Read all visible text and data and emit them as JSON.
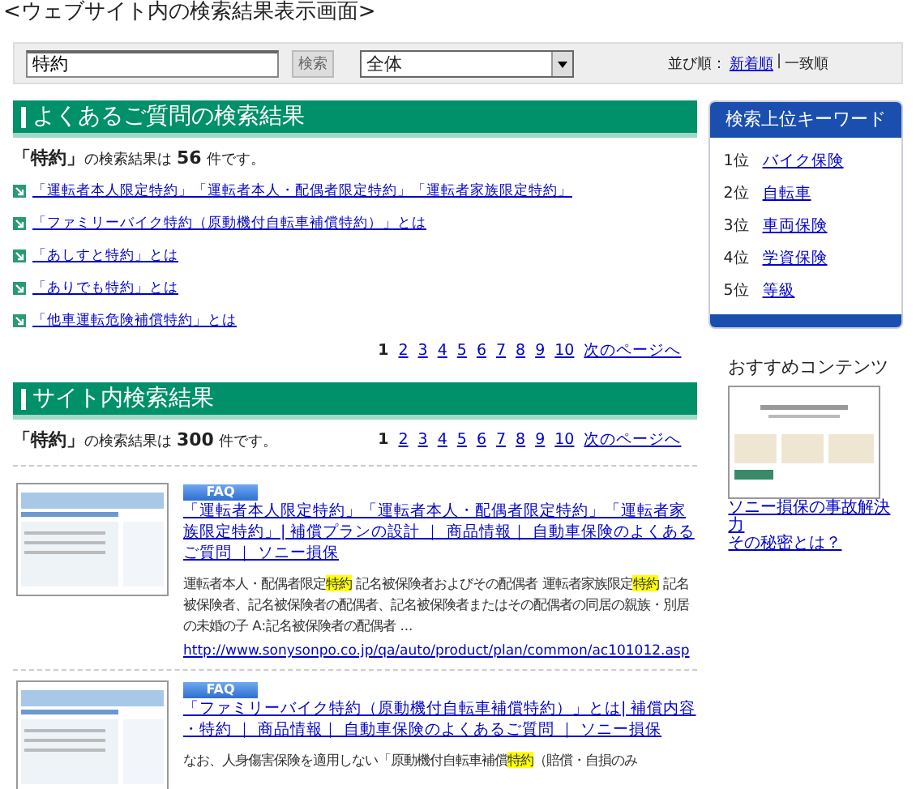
{
  "page_title": "<ウェブサイト内の検索結果表示画面>",
  "search": {
    "value": "特約",
    "button": "検索",
    "scope": "全体",
    "sort_label": "並び順：",
    "sort_separator": "|",
    "sort_options": [
      {
        "label": "新着順",
        "selected": false
      },
      {
        "label": "一致順",
        "selected": true
      }
    ]
  },
  "faq_results": {
    "heading": "よくあるご質問の検索結果",
    "query": "「特約」",
    "count_text": "の検索結果は",
    "count": "56",
    "count_suffix": "件です。",
    "links": [
      "「運転者本人限定特約」「運転者本人・配偶者限定特約」「運転者家族限定特約」",
      "「ファミリーバイク特約（原動機付自転車補償特約）」とは",
      "「あしすと特約」とは",
      "「ありでも特約」とは",
      "「他車運転危険補償特約」とは"
    ],
    "pages": [
      {
        "label": "1",
        "selected": true
      },
      {
        "label": "2",
        "selected": false
      },
      {
        "label": "3",
        "selected": false
      },
      {
        "label": "4",
        "selected": false
      },
      {
        "label": "5",
        "selected": false
      },
      {
        "label": "6",
        "selected": false
      },
      {
        "label": "7",
        "selected": false
      },
      {
        "label": "8",
        "selected": false
      },
      {
        "label": "9",
        "selected": false
      },
      {
        "label": "10",
        "selected": false
      }
    ],
    "next": "次のページへ"
  },
  "site_results": {
    "heading": "サイト内検索結果",
    "query": "「特約」",
    "count_text": "の検索結果は",
    "count": "300",
    "count_suffix": "件です。",
    "pages": [
      {
        "label": "1",
        "selected": true
      },
      {
        "label": "2",
        "selected": false
      },
      {
        "label": "3",
        "selected": false
      },
      {
        "label": "4",
        "selected": false
      },
      {
        "label": "5",
        "selected": false
      },
      {
        "label": "6",
        "selected": false
      },
      {
        "label": "7",
        "selected": false
      },
      {
        "label": "8",
        "selected": false
      },
      {
        "label": "9",
        "selected": false
      },
      {
        "label": "10",
        "selected": false
      }
    ],
    "next": "次のページへ",
    "items": [
      {
        "badge": "FAQ",
        "title": "「運転者本人限定特約」「運転者本人・配偶者限定特約」「運転者家族限定特約」| 補償プランの設計 ｜ 商品情報｜ 自動車保険のよくあるご質問 ｜ ソニー損保",
        "snippet": [
          {
            "text": "運転者本人・配偶者限定",
            "highlight": false
          },
          {
            "text": "特約",
            "highlight": true
          },
          {
            "text": " 記名被保険者およびその配偶者 運転者家族限定",
            "highlight": false
          },
          {
            "text": "特約",
            "highlight": true
          },
          {
            "text": " 記名被保険者、記名被保険者の配偶者、記名被保険者またはその配偶者の同居の親族・別居の未婚の子 A:記名被保険者の配偶者 ...",
            "highlight": false
          }
        ],
        "url": "http://www.sonysonpo.co.jp/qa/auto/product/plan/common/ac101012.asp"
      },
      {
        "badge": "FAQ",
        "title": "「ファミリーバイク特約（原動機付自転車補償特約）」とは| 補償内容・特約 ｜ 商品情報｜ 自動車保険のよくあるご質問 ｜ ソニー損保",
        "snippet": [
          {
            "text": "なお、人身傷害保険を適用しない「原動機付自転車補償",
            "highlight": false
          },
          {
            "text": "特約",
            "highlight": true
          },
          {
            "text": "（賠償・自損のみ",
            "highlight": false
          }
        ]
      }
    ]
  },
  "top_keywords": {
    "heading": "検索上位キーワード",
    "items": [
      {
        "rank": "1位",
        "keyword": "バイク保険"
      },
      {
        "rank": "2位",
        "keyword": "自転車"
      },
      {
        "rank": "3位",
        "keyword": "車両保険"
      },
      {
        "rank": "4位",
        "keyword": "学資保険"
      },
      {
        "rank": "5位",
        "keyword": "等級"
      }
    ]
  },
  "recommended": {
    "heading": "おすすめコンテンツ",
    "link_lines": [
      "ソニー損保の事故解決力",
      "その秘密とは？"
    ]
  }
}
